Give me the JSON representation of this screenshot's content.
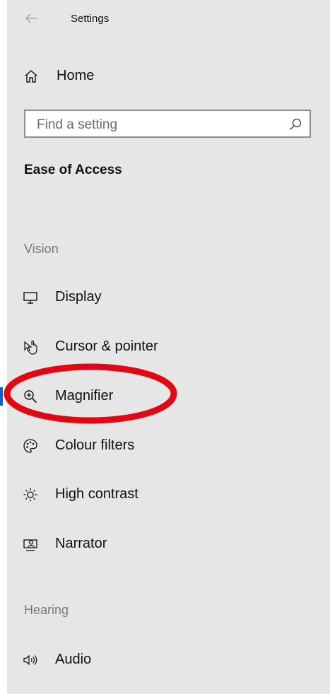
{
  "window": {
    "title": "Settings"
  },
  "home": {
    "label": "Home",
    "icon": "home-icon"
  },
  "search": {
    "placeholder": "Find a setting",
    "value": "",
    "icon": "search-icon"
  },
  "section": {
    "title": "Ease of Access"
  },
  "groups": {
    "vision": "Vision",
    "hearing": "Hearing"
  },
  "nav": {
    "vision_items": [
      {
        "label": "Display",
        "icon": "monitor-icon"
      },
      {
        "label": "Cursor & pointer",
        "icon": "pointer-icon"
      },
      {
        "label": "Magnifier",
        "icon": "magnifier-icon",
        "selected": true
      },
      {
        "label": "Colour filters",
        "icon": "palette-icon"
      },
      {
        "label": "High contrast",
        "icon": "sun-icon"
      },
      {
        "label": "Narrator",
        "icon": "narrator-icon"
      }
    ],
    "hearing_items": [
      {
        "label": "Audio",
        "icon": "speaker-icon"
      }
    ]
  },
  "colors": {
    "panel_bg": "#e6e6e6",
    "accent": "#0a5fd8",
    "annotation": "#e30613"
  }
}
